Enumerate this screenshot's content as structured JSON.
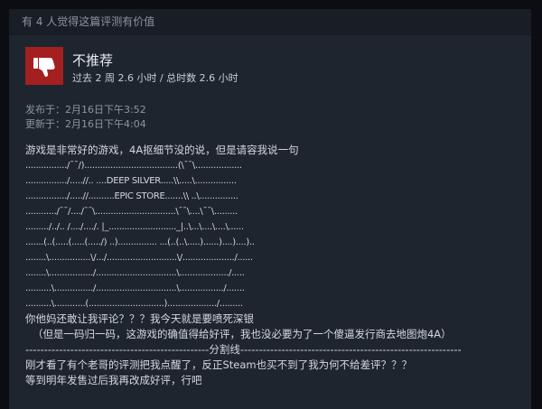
{
  "review": {
    "helpful_text": "有 4 人觉得这篇评测有价值",
    "verdict": {
      "title": "不推荐",
      "hours": "过去 2 周 2.6 小时 / 总时数 2.6 小时",
      "icon": "thumbs-down-icon"
    },
    "dates": {
      "posted_label": "发布于：",
      "posted_value": "2月16日下午3:52",
      "updated_label": "更新于：",
      "updated_value": "2月16日下午4:04"
    },
    "body_lines": [
      "游戏是非常好的游戏，4A抠细节没的说，但是请容我说一句",
      "................/¯¯/)....................................(\\¯¯\\..................",
      "................/.....//.. ....DEEP SILVER.....\\\\.....\\................",
      "................/.....//..........EPIC STORE.......\\\\ ..\\...............",
      "............/¯¯/..../¯¯\\...............................\\¯¯\\....\\¯¯\\.........",
      "........./../.. /..../..../. |_.........................._|..\\...\\....\\....\\......",
      ".......(..(.....(.....(...../) ..)............... ...(..(..\\.....)......)....)....)..",
      "........\\................\\/.../...........................\\/..................../......",
      "........\\................./...............................\\.................../.....",
      "..........\\.............../...............................\\................./.......",
      "..........\\............(.............................)................./........."
    ],
    "ascii_tail": [
      "..........\\............(.............................).................../.........",
      "你他妈还敢让我评论？？？我今天就是要喷死深银",
      "（但是一码归一码，这游戏的确值得给好评，我也没必要为了一个傻逼发行商去地图炮4A）",
      "-------------------------------------------------分割线-----------------------------------------------------------",
      "刚才看了有个老哥的评测把我点醒了，反正Steam也买不到了我为何不给差评？？？",
      "等到明年发售过后我再改成好评，行吧"
    ]
  }
}
